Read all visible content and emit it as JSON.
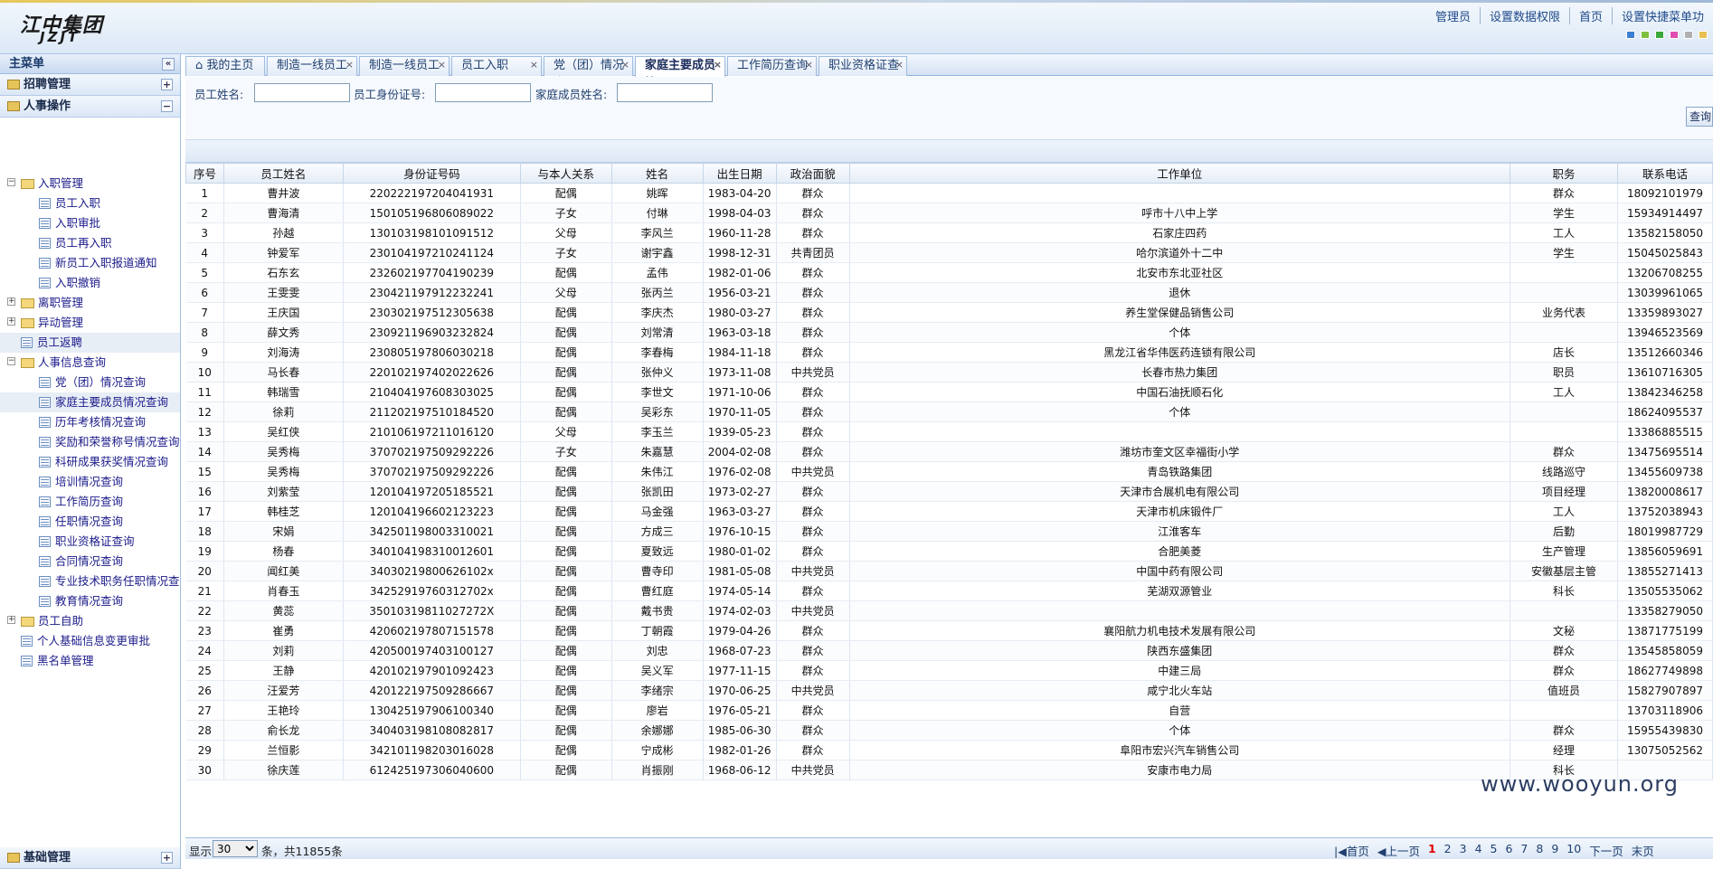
{
  "header": {
    "logo_cn": "江中集团",
    "logo_en": "JZJT",
    "links": [
      "管理员",
      "设置数据权限",
      "首页",
      "设置快捷菜单功"
    ],
    "swatch_colors": [
      "#3a7fd0",
      "#7fbf3f",
      "#3aa83a",
      "#e04fb0",
      "#b0b0b0",
      "#e8c050"
    ]
  },
  "sidebar": {
    "title": "主菜单",
    "collapse_icon": "«",
    "groups_top": [
      {
        "label": "招聘管理",
        "toggle": "+"
      },
      {
        "label": "人事操作",
        "toggle": "−"
      }
    ],
    "tree": [
      {
        "label": "入职管理",
        "type": "folder",
        "level": 1,
        "expanded": true
      },
      {
        "label": "员工入职",
        "type": "page",
        "level": 2
      },
      {
        "label": "入职审批",
        "type": "page",
        "level": 2
      },
      {
        "label": "员工再入职",
        "type": "page",
        "level": 2
      },
      {
        "label": "新员工入职报道通知",
        "type": "page",
        "level": 2
      },
      {
        "label": "入职撤销",
        "type": "page",
        "level": 2
      },
      {
        "label": "离职管理",
        "type": "folder",
        "level": 1,
        "expanded": false
      },
      {
        "label": "异动管理",
        "type": "folder",
        "level": 1,
        "expanded": false
      },
      {
        "label": "员工返聘",
        "type": "page",
        "level": 1,
        "selected": true
      },
      {
        "label": "人事信息查询",
        "type": "folder",
        "level": 1,
        "expanded": true
      },
      {
        "label": "党（团）情况查询",
        "type": "page",
        "level": 2
      },
      {
        "label": "家庭主要成员情况查询",
        "type": "page",
        "level": 2,
        "selected": true
      },
      {
        "label": "历年考核情况查询",
        "type": "page",
        "level": 2
      },
      {
        "label": "奖励和荣誉称号情况查询",
        "type": "page",
        "level": 2
      },
      {
        "label": "科研成果获奖情况查询",
        "type": "page",
        "level": 2
      },
      {
        "label": "培训情况查询",
        "type": "page",
        "level": 2
      },
      {
        "label": "工作简历查询",
        "type": "page",
        "level": 2
      },
      {
        "label": "任职情况查询",
        "type": "page",
        "level": 2
      },
      {
        "label": "职业资格证查询",
        "type": "page",
        "level": 2
      },
      {
        "label": "合同情况查询",
        "type": "page",
        "level": 2
      },
      {
        "label": "专业技术职务任职情况查",
        "type": "page",
        "level": 2
      },
      {
        "label": "教育情况查询",
        "type": "page",
        "level": 2
      },
      {
        "label": "员工自助",
        "type": "folder",
        "level": 1,
        "expanded": false
      },
      {
        "label": "个人基础信息变更审批",
        "type": "page",
        "level": 1
      },
      {
        "label": "黑名单管理",
        "type": "page",
        "level": 1
      }
    ],
    "bottom_group": {
      "label": "基础管理",
      "toggle": "+"
    }
  },
  "tabs": [
    {
      "label": "我的主页",
      "active": false,
      "closable": false
    },
    {
      "label": "制造一线员工录",
      "active": false,
      "closable": true
    },
    {
      "label": "制造一线员工录",
      "active": false,
      "closable": true
    },
    {
      "label": "员工入职",
      "active": false,
      "closable": true
    },
    {
      "label": "党（团）情况查",
      "active": false,
      "closable": true
    },
    {
      "label": "家庭主要成员情",
      "active": true,
      "closable": true
    },
    {
      "label": "工作简历查询",
      "active": false,
      "closable": true
    },
    {
      "label": "职业资格证查询",
      "active": false,
      "closable": true
    }
  ],
  "search": {
    "emp_name_label": "员工姓名:",
    "emp_id_label": "员工身份证号:",
    "family_name_label": "家庭成员姓名:",
    "emp_name_value": "",
    "emp_id_value": "",
    "family_name_value": "",
    "query_button": "查询"
  },
  "table": {
    "columns": [
      "序号",
      "员工姓名",
      "身份证号码",
      "与本人关系",
      "姓名",
      "出生日期",
      "政治面貌",
      "工作单位",
      "职务",
      "联系电话"
    ],
    "rows": [
      [
        "1",
        "曹井波",
        "220222197204041931",
        "配偶",
        "姚晖",
        "1983-04-20",
        "群众",
        "",
        "群众",
        "18092101979"
      ],
      [
        "2",
        "曹海清",
        "150105196806089022",
        "子女",
        "付琳",
        "1998-04-03",
        "群众",
        "呼市十八中上学",
        "学生",
        "15934914497"
      ],
      [
        "3",
        "孙越",
        "130103198101091512",
        "父母",
        "李风兰",
        "1960-11-28",
        "群众",
        "石家庄四药",
        "工人",
        "13582158050"
      ],
      [
        "4",
        "钟爱军",
        "230104197210241124",
        "子女",
        "谢宇鑫",
        "1998-12-31",
        "共青团员",
        "哈尔滨道外十二中",
        "学生",
        "15045025843"
      ],
      [
        "5",
        "石东玄",
        "232602197704190239",
        "配偶",
        "孟伟",
        "1982-01-06",
        "群众",
        "北安市东北亚社区",
        "",
        "13206708255"
      ],
      [
        "6",
        "王雯雯",
        "230421197912232241",
        "父母",
        "张丙兰",
        "1956-03-21",
        "群众",
        "退休",
        "",
        "13039961065"
      ],
      [
        "7",
        "王庆国",
        "230302197512305638",
        "配偶",
        "李庆杰",
        "1980-03-27",
        "群众",
        "养生堂保健品销售公司",
        "业务代表",
        "13359893027"
      ],
      [
        "8",
        "薛文秀",
        "230921196903232824",
        "配偶",
        "刘常清",
        "1963-03-18",
        "群众",
        "个体",
        "",
        "13946523569"
      ],
      [
        "9",
        "刘海涛",
        "230805197806030218",
        "配偶",
        "李春梅",
        "1984-11-18",
        "群众",
        "黑龙江省华伟医药连锁有限公司",
        "店长",
        "13512660346"
      ],
      [
        "10",
        "马长春",
        "220102197402022626",
        "配偶",
        "张仲义",
        "1973-11-08",
        "中共党员",
        "长春市热力集团",
        "职员",
        "13610716305"
      ],
      [
        "11",
        "韩瑞雪",
        "210404197608303025",
        "配偶",
        "李世文",
        "1971-10-06",
        "群众",
        "中国石油抚顺石化",
        "工人",
        "13842346258"
      ],
      [
        "12",
        "徐莉",
        "211202197510184520",
        "配偶",
        "吴彩东",
        "1970-11-05",
        "群众",
        "个体",
        "",
        "18624095537"
      ],
      [
        "13",
        "吴红侠",
        "210106197211016120",
        "父母",
        "李玉兰",
        "1939-05-23",
        "群众",
        "",
        "",
        "13386885515"
      ],
      [
        "14",
        "吴秀梅",
        "370702197509292226",
        "子女",
        "朱嘉慧",
        "2004-02-08",
        "群众",
        "潍坊市奎文区幸福街小学",
        "群众",
        "13475695514"
      ],
      [
        "15",
        "吴秀梅",
        "370702197509292226",
        "配偶",
        "朱伟江",
        "1976-02-08",
        "中共党员",
        "青岛铁路集团",
        "线路巡守",
        "13455609738"
      ],
      [
        "16",
        "刘紫莹",
        "120104197205185521",
        "配偶",
        "张凯田",
        "1973-02-27",
        "群众",
        "天津市合展机电有限公司",
        "项目经理",
        "13820008617"
      ],
      [
        "17",
        "韩桂芝",
        "120104196602123223",
        "配偶",
        "马金强",
        "1963-03-27",
        "群众",
        "天津市机床锻件厂",
        "工人",
        "13752038943"
      ],
      [
        "18",
        "宋娟",
        "342501198003310021",
        "配偶",
        "方成三",
        "1976-10-15",
        "群众",
        "江淮客车",
        "后勤",
        "18019987729"
      ],
      [
        "19",
        "杨春",
        "340104198310012601",
        "配偶",
        "夏致远",
        "1980-01-02",
        "群众",
        "合肥美菱",
        "生产管理",
        "13856059691"
      ],
      [
        "20",
        "闻红美",
        "34030219800626102x",
        "配偶",
        "曹寺印",
        "1981-05-08",
        "中共党员",
        "中国中药有限公司",
        "安徽基层主管",
        "13855271413"
      ],
      [
        "21",
        "肖春玉",
        "34252919760312702x",
        "配偶",
        "曹红庭",
        "1974-05-14",
        "群众",
        "芜湖双源管业",
        "科长",
        "13505535062"
      ],
      [
        "22",
        "黄蕊",
        "35010319811027272X",
        "配偶",
        "戴书贵",
        "1974-02-03",
        "中共党员",
        "",
        "",
        "13358279050"
      ],
      [
        "23",
        "崔勇",
        "420602197807151578",
        "配偶",
        "丁朝霞",
        "1979-04-26",
        "群众",
        "襄阳航力机电技术发展有限公司",
        "文秘",
        "13871775199"
      ],
      [
        "24",
        "刘莉",
        "420500197403100127",
        "配偶",
        "刘忠",
        "1968-07-23",
        "群众",
        "陕西东盛集团",
        "群众",
        "13545858059"
      ],
      [
        "25",
        "王静",
        "420102197901092423",
        "配偶",
        "吴义军",
        "1977-11-15",
        "群众",
        "中建三局",
        "群众",
        "18627749898"
      ],
      [
        "26",
        "汪爱芳",
        "420122197509286667",
        "配偶",
        "李绪宗",
        "1970-06-25",
        "中共党员",
        "咸宁北火车站",
        "值班员",
        "15827907897"
      ],
      [
        "27",
        "王艳玲",
        "130425197906100340",
        "配偶",
        "廖岩",
        "1976-05-21",
        "群众",
        "自营",
        "",
        "13703118906"
      ],
      [
        "28",
        "俞长龙",
        "340403198108082817",
        "配偶",
        "余娜娜",
        "1985-06-30",
        "群众",
        "个体",
        "群众",
        "15955439830"
      ],
      [
        "29",
        "兰恒影",
        "342101198203016028",
        "配偶",
        "宁成彬",
        "1982-01-26",
        "群众",
        "阜阳市宏兴汽车销售公司",
        "经理",
        "13075052562"
      ],
      [
        "30",
        "徐庆莲",
        "612425197306040600",
        "配偶",
        "肖振刚",
        "1968-06-12",
        "中共党员",
        "安康市电力局",
        "科长",
        ""
      ]
    ]
  },
  "footer": {
    "show_label": "显示",
    "page_size": "30",
    "total_text": "条，共11855条",
    "first": "|◀首页",
    "prev": "◀上一页",
    "pages": [
      "1",
      "2",
      "3",
      "4",
      "5",
      "6",
      "7",
      "8",
      "9",
      "10"
    ],
    "current_page": "1",
    "next": "下一页",
    "last": "末页"
  },
  "watermark": "www.wooyun.org"
}
